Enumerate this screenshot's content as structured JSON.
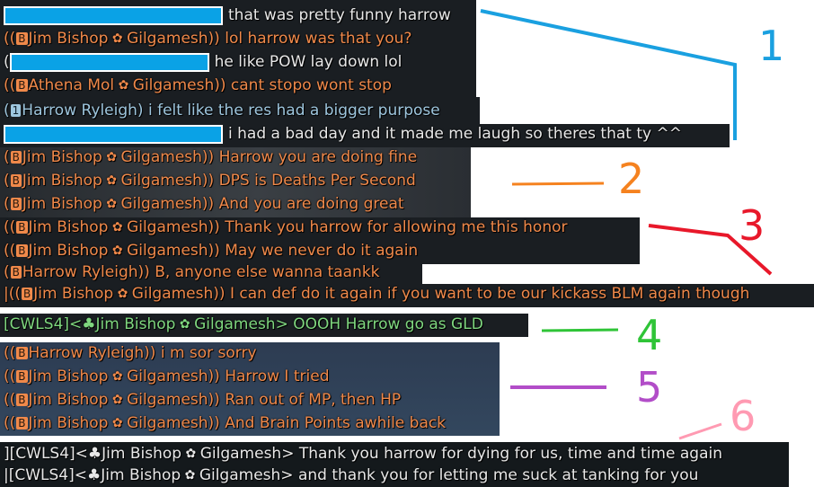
{
  "chat": {
    "lines": [
      {
        "type": "redacted",
        "text": "that was pretty funny harrow"
      },
      {
        "type": "ls",
        "open": "((",
        "badge": "B",
        "speaker": "Jim Bishop",
        "world": "Gilgamesh",
        "close": "))",
        "text": "lol harrow was that you?"
      },
      {
        "type": "redacted",
        "prefix": "(",
        "text": "he like POW lay down lol"
      },
      {
        "type": "ls",
        "open": "((",
        "badge": "B",
        "speaker": "Athena Mol",
        "world": "Gilgamesh",
        "close": "))",
        "text": "cant stopo wont stop"
      },
      {
        "type": "party",
        "open": "(",
        "badge": "1",
        "speaker": "Harrow Ryleigh",
        "close": ")",
        "text": "i felt like the res had a bigger purpose"
      },
      {
        "type": "redacted",
        "text": "i had a bad day and it made me laugh so theres that ty ^^"
      },
      {
        "type": "ls",
        "open": "(",
        "badge": "B",
        "speaker": "Jim Bishop",
        "world": "Gilgamesh",
        "close": "))",
        "text": "Harrow you are doing fine"
      },
      {
        "type": "ls",
        "open": "(",
        "badge": "B",
        "speaker": "Jim Bishop",
        "world": "Gilgamesh",
        "close": "))",
        "text": "DPS is Deaths Per Second"
      },
      {
        "type": "ls",
        "open": "(",
        "badge": "B",
        "speaker": "Jim Bishop",
        "world": "Gilgamesh",
        "close": "))",
        "text": "And you are doing great"
      },
      {
        "type": "ls",
        "open": "((",
        "badge": "B",
        "speaker": "Jim Bishop",
        "world": "Gilgamesh",
        "close": "))",
        "text": "Thank you harrow for allowing me this honor"
      },
      {
        "type": "ls",
        "open": "((",
        "badge": "B",
        "speaker": "Jim Bishop",
        "world": "Gilgamesh",
        "close": "))",
        "text": "May we never do it again"
      },
      {
        "type": "ls",
        "open": "(",
        "badge": "B",
        "speaker": "Harrow Ryleigh",
        "close": "))",
        "text": "B, anyone else wanna taankk"
      },
      {
        "type": "ls",
        "open": "|((",
        "badge": "B",
        "speaker": "Jim Bishop",
        "world": "Gilgamesh",
        "close": "))",
        "text": "I can def do it again if you want to be our kickass BLM again though"
      },
      {
        "type": "cwls",
        "open": "[CWLS4]<",
        "club": "♣",
        "speaker": "Jim Bishop",
        "world": "Gilgamesh",
        "close": ">",
        "text": "OOOH Harrow go as GLD"
      },
      {
        "type": "ls",
        "open": "((",
        "badge": "B",
        "speaker": "Harrow Ryleigh",
        "close": "))",
        "text": "i m sor sorry"
      },
      {
        "type": "ls",
        "open": "((",
        "badge": "B",
        "speaker": "Jim Bishop",
        "world": "Gilgamesh",
        "close": "))",
        "text": "Harrow I tried"
      },
      {
        "type": "ls",
        "open": "((",
        "badge": "B",
        "speaker": "Jim Bishop",
        "world": "Gilgamesh",
        "close": "))",
        "text": "Ran out of MP, then HP"
      },
      {
        "type": "ls",
        "open": "((",
        "badge": "B",
        "speaker": "Jim Bishop",
        "world": "Gilgamesh",
        "close": "))",
        "text": "And Brain Points awhile back"
      },
      {
        "type": "cwls-white",
        "open": "][CWLS4]<",
        "club": "♣",
        "speaker": "Jim Bishop",
        "world": "Gilgamesh",
        "close": ">",
        "text": "Thank you harrow for dying for us, time and time again"
      },
      {
        "type": "cwls-white",
        "open": "|[CWLS4]<",
        "club": "♣",
        "speaker": "Jim Bishop",
        "world": "Gilgamesh",
        "close": ">",
        "text": "and thank you for letting me suck at tanking for you"
      }
    ]
  },
  "annotations": [
    "1",
    "2",
    "3",
    "4",
    "5",
    "6"
  ],
  "colors": {
    "anno1": "#1aa0e0",
    "anno2": "#f5821f",
    "anno3": "#e8182a",
    "anno4": "#2fc437",
    "anno5": "#b24dc8",
    "anno6": "#ff9ab2",
    "linkshell": "#f0894a",
    "cwls": "#7fd77f",
    "party": "#9ec6de",
    "redaction": "#0aa2e6"
  }
}
